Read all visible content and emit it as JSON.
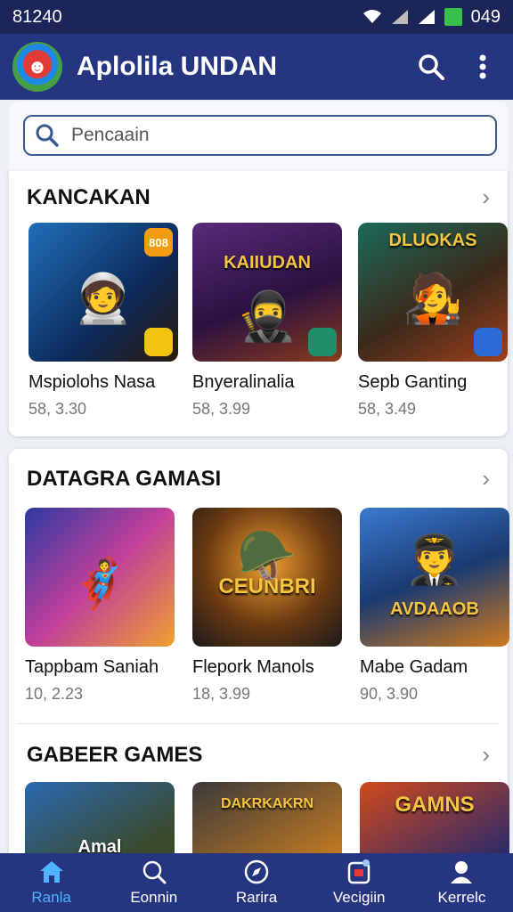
{
  "status_bar": {
    "time": "81240",
    "battery_text": "049"
  },
  "app_bar": {
    "title": "Aplolila UNDAN"
  },
  "search": {
    "placeholder": "Pencaain"
  },
  "sections": [
    {
      "title": "KANCAKAN",
      "items": [
        {
          "name": "Mspiolohs Nasa",
          "price": "58, 3.30",
          "badge_text": "808",
          "art_title": ""
        },
        {
          "name": "Bnyeralinalia",
          "price": "58, 3.99",
          "badge_text": "",
          "art_title": "KAIIUDAN"
        },
        {
          "name": "Sepb Ganting",
          "price": "58, 3.49",
          "badge_text": "",
          "art_title": "DLUOKAS"
        }
      ]
    },
    {
      "title": "DATAGRA GAMASI",
      "items": [
        {
          "name": "Tappbam Saniah",
          "price": "10, 2.23",
          "art_title": ""
        },
        {
          "name": "Flepork Manols",
          "price": "18, 3.99",
          "art_title": "CEUNBRI"
        },
        {
          "name": "Mabe Gadam",
          "price": "90, 3.90",
          "art_title": "AVDAAOB"
        }
      ]
    },
    {
      "title": "GABEER GAMES",
      "items": [
        {
          "name": "",
          "price": "",
          "art_title": "Amal"
        },
        {
          "name": "",
          "price": "",
          "art_title": "DAKRKAKRN"
        },
        {
          "name": "",
          "price": "",
          "art_title": "GAMNS"
        }
      ]
    }
  ],
  "bottom_nav": [
    {
      "label": "Ranla",
      "icon": "home-icon",
      "active": true
    },
    {
      "label": "Eonnin",
      "icon": "search-icon",
      "active": false
    },
    {
      "label": "Rarira",
      "icon": "compass-icon",
      "active": false
    },
    {
      "label": "Vecigiin",
      "icon": "downloads-icon",
      "active": false
    },
    {
      "label": "Kerrelc",
      "icon": "profile-icon",
      "active": false
    }
  ],
  "colors": {
    "app_bar": "#263580",
    "status_bar": "#1c2557",
    "active_nav": "#4fb3ff",
    "background": "#eceff4"
  }
}
